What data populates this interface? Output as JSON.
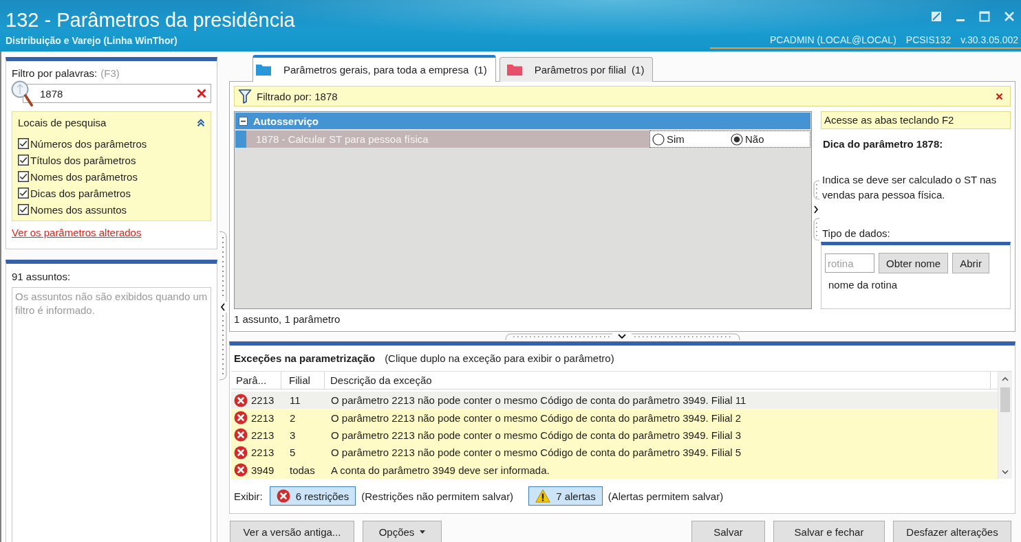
{
  "window": {
    "title": "132 - Parâmetros da presidência",
    "subtitle": "Distribuição e Varejo (Linha WinThor)",
    "user": "PCADMIN (LOCAL@LOCAL)",
    "routine": "PCSIS132",
    "version": "v.30.3.05.002"
  },
  "filter_panel": {
    "label": "Filtro por palavras:",
    "shortcut": "(F3)",
    "search": {
      "value": "1878"
    },
    "search_locations": {
      "title": "Locais de pesquisa",
      "expanded": true,
      "options": [
        {
          "label": "Números dos parâmetros",
          "checked": true
        },
        {
          "label": "Títulos dos parâmetros",
          "checked": true
        },
        {
          "label": "Nomes dos parâmetros",
          "checked": true
        },
        {
          "label": "Dicas dos parâmetros",
          "checked": true
        },
        {
          "label": "Nomes dos assuntos",
          "checked": true
        }
      ]
    },
    "changed_link": "Ver os parâmetros alterados"
  },
  "subjects_panel": {
    "count": "91 assuntos:",
    "message": "Os assuntos não são exibidos quando um filtro é informado."
  },
  "tabs": [
    {
      "label": "Parâmetros gerais, para toda a empresa",
      "count": "(1)",
      "color": "#2a97d8",
      "selected": true
    },
    {
      "label": "Parâmetros por filial",
      "count": "(1)",
      "color": "#e8506a",
      "selected": false
    }
  ],
  "filter_bar": {
    "text": "Filtrado por: 1878"
  },
  "parameter_grid": {
    "groups": [
      {
        "title": "Autosserviço",
        "expanded": true,
        "parameters": [
          {
            "title": "1878 - Calcular ST para pessoa física",
            "selected": true,
            "options": [
              {
                "label": "Sim",
                "selected": false
              },
              {
                "label": "Não",
                "selected": true
              }
            ]
          }
        ]
      }
    ],
    "summary": "1 assunto, 1 parâmetro"
  },
  "hint_panel": {
    "tip": "Acesse as abas teclando F2",
    "title": "Dica do parâmetro 1878:",
    "description": "Indica se deve ser calculado o ST nas vendas para pessoa física.",
    "data_type_label": "Tipo de dados:",
    "routine": {
      "placeholder": "rotina",
      "buttons": [
        "Obter nome",
        "Abrir"
      ],
      "name": "nome da rotina"
    }
  },
  "exceptions": {
    "title": "Exceções na parametrização",
    "hint": "(Clique duplo na exceção para exibir o parâmetro)",
    "columns": [
      "Parâ...",
      "Filial",
      "Descrição da exceção"
    ],
    "rows": [
      {
        "kind": "restriction",
        "parameter": "2213",
        "branch": "11",
        "description": "O parâmetro 2213 não pode conter o mesmo Código de conta do parâmetro 3949. Filial 11",
        "selected": true
      },
      {
        "kind": "restriction",
        "parameter": "2213",
        "branch": "2",
        "description": "O parâmetro 2213 não pode conter o mesmo Código de conta do parâmetro 3949. Filial 2",
        "selected": false
      },
      {
        "kind": "restriction",
        "parameter": "2213",
        "branch": "3",
        "description": "O parâmetro 2213 não pode conter o mesmo Código de conta do parâmetro 3949. Filial 3",
        "selected": false
      },
      {
        "kind": "restriction",
        "parameter": "2213",
        "branch": "5",
        "description": "O parâmetro 2213 não pode conter o mesmo Código de conta do parâmetro 3949. Filial 5",
        "selected": false
      },
      {
        "kind": "restriction",
        "parameter": "3949",
        "branch": "todas",
        "description": "A conta do parâmetro 3949 deve ser informada.",
        "selected": false
      }
    ],
    "filter_label": "Exibir:",
    "filters": [
      {
        "kind": "restriction",
        "label": "6 restrições",
        "note": "(Restrições não permitem salvar)",
        "pressed": true
      },
      {
        "kind": "alert",
        "label": "7 alertas",
        "note": "(Alertas permitem salvar)",
        "pressed": true
      }
    ]
  },
  "buttons": {
    "left": [
      {
        "label": "Ver a versão antiga...",
        "kind": "plain"
      },
      {
        "label": "Opções",
        "kind": "dropdown"
      }
    ],
    "right": [
      "Salvar",
      "Salvar e fechar",
      "Desfazer alterações"
    ]
  }
}
